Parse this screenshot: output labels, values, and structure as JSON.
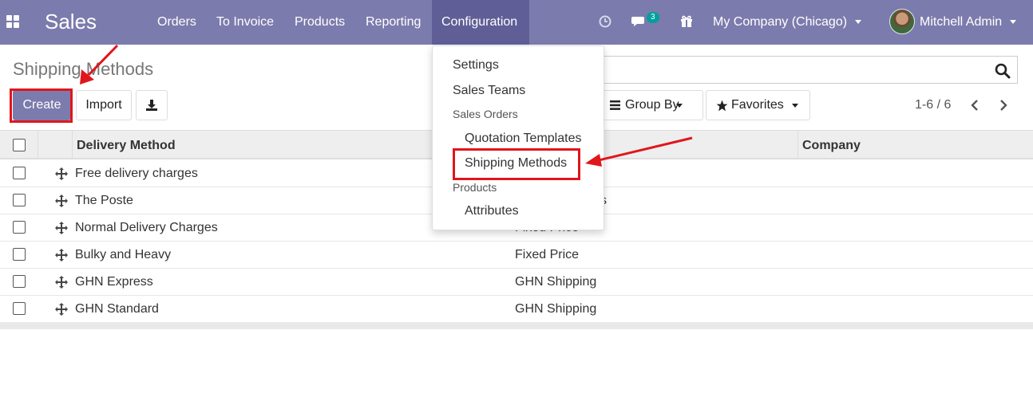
{
  "navbar": {
    "brand": "Sales",
    "menu": [
      "Orders",
      "To Invoice",
      "Products",
      "Reporting",
      "Configuration"
    ],
    "active_menu": "Configuration",
    "messages_count": "3",
    "company": "My Company (Chicago)",
    "user": "Mitchell Admin",
    "bg_color": "#7c7bad"
  },
  "control_panel": {
    "title": "Shipping Methods",
    "create_label": "Create",
    "import_label": "Import",
    "group_by_label": "Group By",
    "favorites_label": "Favorites",
    "pager": "1-6 / 6"
  },
  "table": {
    "columns": [
      "Delivery Method",
      "Company"
    ],
    "rows": [
      {
        "name": "Free delivery charges",
        "provider": ""
      },
      {
        "name": "The Poste",
        "provider": "s"
      },
      {
        "name": "Normal Delivery Charges",
        "provider": "Fixed Price"
      },
      {
        "name": "Bulky and Heavy",
        "provider": "Fixed Price"
      },
      {
        "name": "GHN Express",
        "provider": "GHN Shipping"
      },
      {
        "name": "GHN Standard",
        "provider": "GHN Shipping"
      }
    ]
  },
  "config_dropdown": {
    "items": [
      "Settings",
      "Sales Teams"
    ],
    "section_sales_orders": "Sales Orders",
    "sales_orders_items": [
      "Quotation Templates",
      "Shipping Methods"
    ],
    "section_products": "Products",
    "products_items": [
      "Attributes"
    ]
  },
  "icons": [
    "apps-icon",
    "clock-icon",
    "chat-icon",
    "gift-icon",
    "search-icon",
    "download-icon",
    "bars-icon",
    "star-icon",
    "chevron-left-icon",
    "chevron-right-icon",
    "drag-handle-icon"
  ],
  "annotation_color": "#e0161c"
}
